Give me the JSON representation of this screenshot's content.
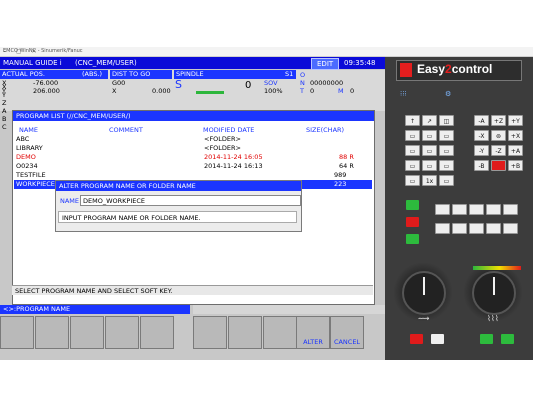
{
  "window": {
    "title": "EMCO WinNC - Sinumerik/Fanuc"
  },
  "header": {
    "mode": "MANUAL GUIDE i",
    "path": "(CNC_MEM/USER)",
    "edit": "EDIT",
    "time": "09:35:48"
  },
  "position": {
    "actual_label": "ACTUAL POS.",
    "abs_label": "(ABS.)",
    "axes": [
      {
        "name": "X",
        "value": "-76.000"
      },
      {
        "name": "Y",
        "value": "206.000"
      }
    ],
    "dist_label": "DIST TO GO",
    "g_code": "G00",
    "dist_x": "0.000",
    "spindle_label": "SPINDLE",
    "s1": "S1",
    "s_letter": "S",
    "s_value": "0",
    "sov_label": "SOV",
    "sov_value": "100%",
    "o_label": "O",
    "n_label": "N",
    "n_value": "00000000",
    "t_label": "T",
    "t_value": "0",
    "m_label": "M",
    "m_value": "0",
    "left_axes": [
      "X",
      "Y",
      "Z",
      "A",
      "B",
      "C"
    ]
  },
  "program_list": {
    "title": "PROGRAM LIST (//CNC_MEM/USER/)",
    "columns": {
      "name": "NAME",
      "comment": "COMMENT",
      "modified": "MODIFIED DATE",
      "size": "SIZE(CHAR)"
    },
    "rows": [
      {
        "name": "ABC",
        "modified": "<FOLDER>",
        "size": ""
      },
      {
        "name": "LIBRARY",
        "modified": "<FOLDER>",
        "size": ""
      },
      {
        "name": "DEMO",
        "modified": "2014-11-24 16:05",
        "size": "88 R"
      },
      {
        "name": "O0234",
        "modified": "2014-11-24 16:13",
        "size": "64 R"
      },
      {
        "name": "TESTFILE",
        "modified": "",
        "size": "989"
      },
      {
        "name": "WORKPIECE",
        "modified": "",
        "size": "223"
      }
    ]
  },
  "dialog": {
    "title": "ALTER PROGRAM NAME OR FOLDER NAME",
    "name_label": "NAME",
    "name_value": "DEMO_WORKPIECE",
    "instruction": "INPUT PROGRAM NAME OR FOLDER NAME."
  },
  "message": "SELECT PROGRAM NAME AND SELECT SOFT KEY.",
  "program_name_bar": "<>:PROGRAM NAME",
  "softkeys": [
    "",
    "",
    "",
    "",
    "",
    "",
    "",
    "",
    "",
    "ALTER",
    "CANCEL",
    ""
  ],
  "panel": {
    "brand_a": "Easy",
    "brand_b": "2",
    "brand_c": "control",
    "keys": [
      "-A",
      "+Z",
      "+Y",
      "-X",
      "+X",
      "-Y",
      "-Z",
      "+A",
      "-B",
      "+B",
      "1x"
    ]
  },
  "colors": {
    "accent": "#1b35ff",
    "alert": "#e00000",
    "panel": "#3c3c3c",
    "brand_red": "#e41e1e"
  }
}
